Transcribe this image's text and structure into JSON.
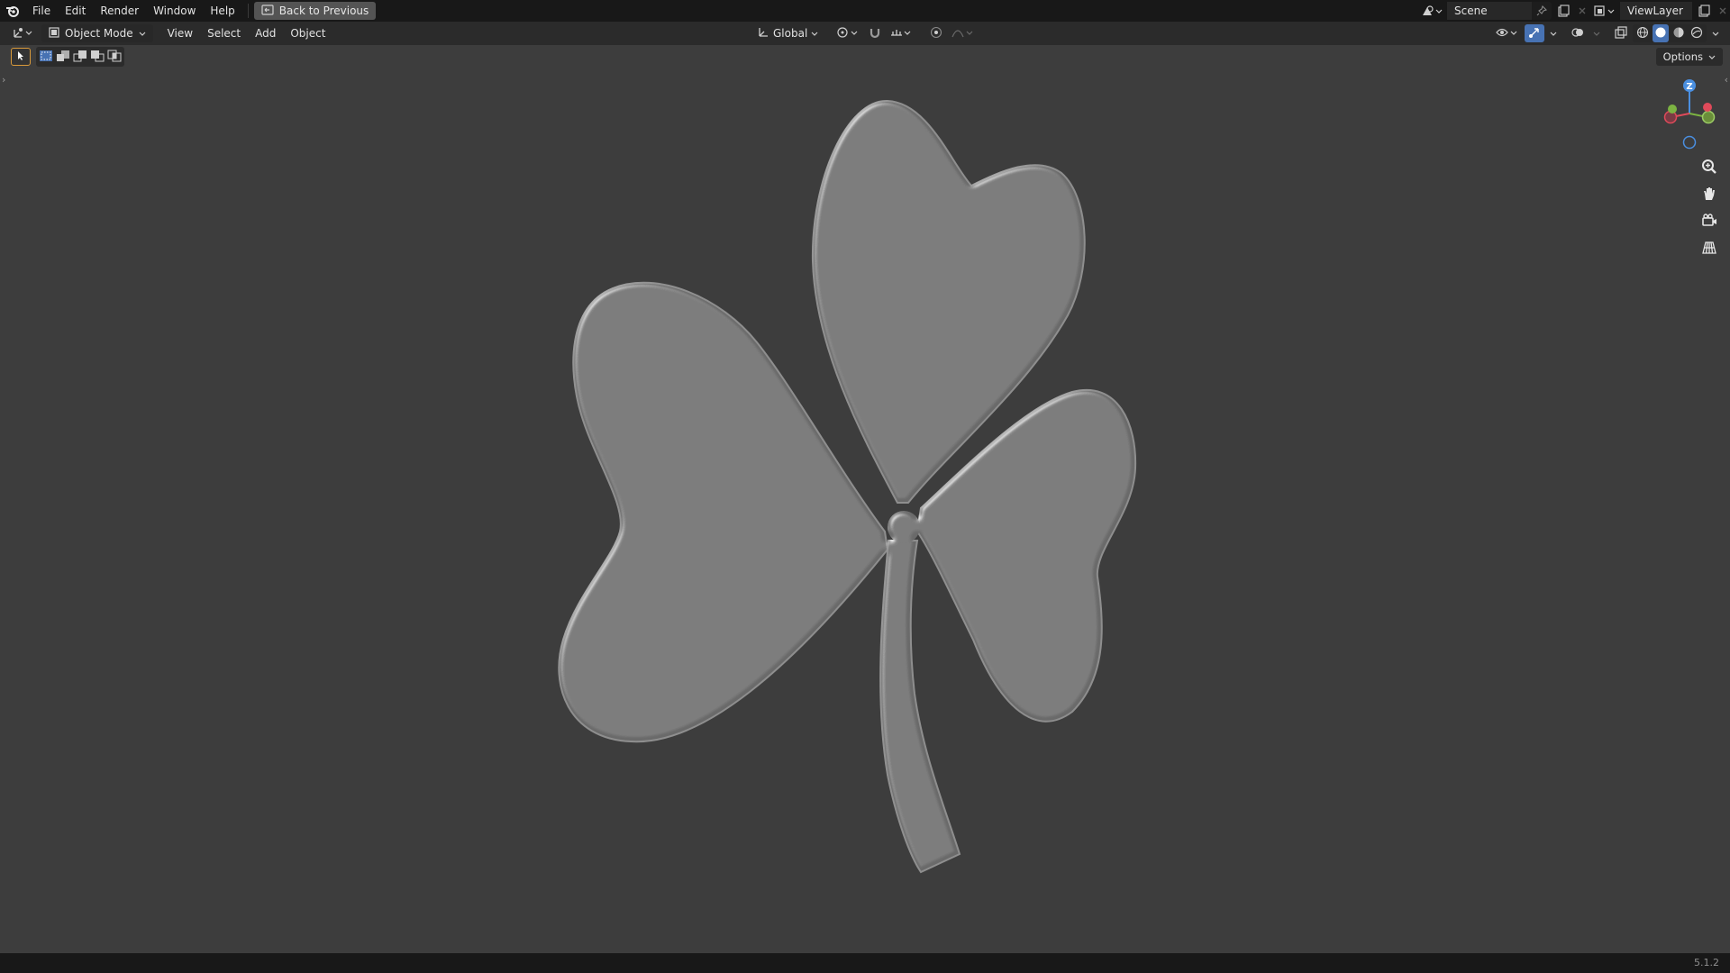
{
  "app": {
    "logo": "blender-logo-icon"
  },
  "topbar": {
    "menu": [
      "File",
      "Edit",
      "Render",
      "Window",
      "Help"
    ],
    "back_label": "Back to Previous",
    "scene_label": "Scene",
    "viewlayer_label": "ViewLayer"
  },
  "header": {
    "mode_label": "Object Mode",
    "menus": [
      "View",
      "Select",
      "Add",
      "Object"
    ],
    "transform_orientation": "Global"
  },
  "toolbar": {
    "options_label": "Options"
  },
  "gizmo": {
    "z_label": "Z"
  },
  "status": {
    "version": "5.1.2"
  },
  "colors": {
    "viewport_bg": "#3d3d3d",
    "header_bg": "#2b2b2b",
    "topbar_bg": "#181818",
    "accent_blue": "#4772b3",
    "axis_x": "#e04a5a",
    "axis_y": "#7cb342",
    "axis_z": "#4a8fe0",
    "mesh_fill": "#6b6b6b"
  },
  "viewport_object": {
    "icon": "shamrock-mesh"
  }
}
